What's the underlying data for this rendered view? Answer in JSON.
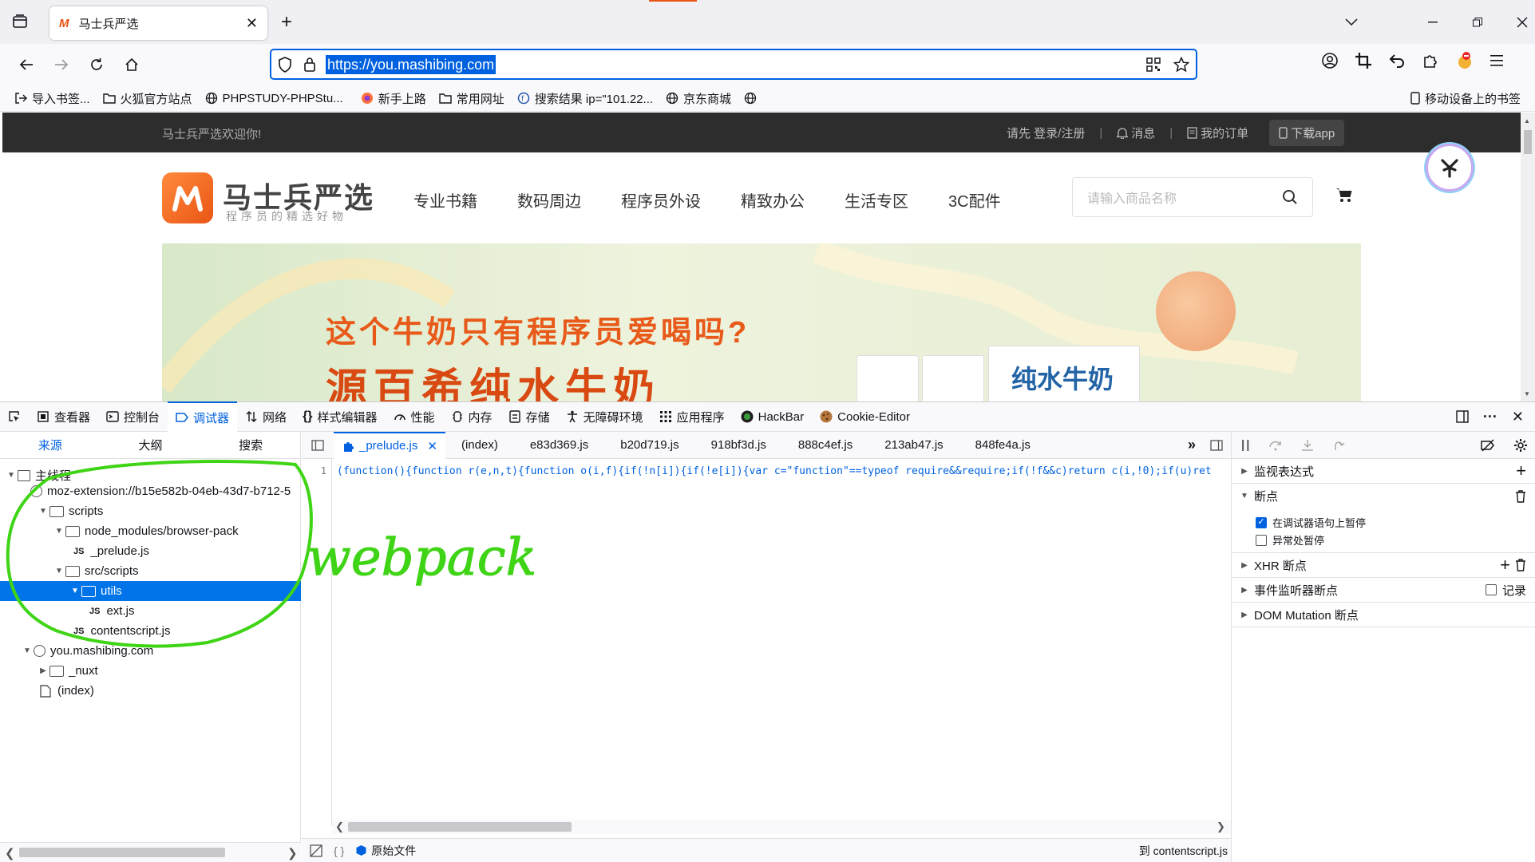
{
  "browser": {
    "tab_title": "马士兵严选",
    "url": "https://you.mashibing.com",
    "bookmarks": [
      "导入书签...",
      "火狐官方站点",
      "PHPSTUDY-PHPStu...",
      "新手上路",
      "常用网址",
      "搜索结果 ip=\"101.22...",
      "京东商城"
    ],
    "mobile_bookmarks": "移动设备上的书签"
  },
  "site": {
    "welcome": "马士兵严选欢迎你!",
    "login": "请先 登录/注册",
    "messages": "消息",
    "orders": "我的订单",
    "download": "下载app",
    "logo_name": "马士兵严选",
    "logo_sub": "程序员的精选好物",
    "nav": [
      "专业书籍",
      "数码周边",
      "程序员外设",
      "精致办公",
      "生活专区",
      "3C配件"
    ],
    "search_placeholder": "请输入商品名称",
    "banner_title": "这个牛奶只有程序员爱喝吗?",
    "banner_title2": "源百希纯水牛奶",
    "milk_label": "纯水牛奶"
  },
  "devtools": {
    "tools": [
      "查看器",
      "控制台",
      "调试器",
      "网络",
      "样式编辑器",
      "性能",
      "内存",
      "存储",
      "无障碍环境",
      "应用程序",
      "HackBar",
      "Cookie-Editor"
    ],
    "left_tabs": [
      "来源",
      "大纲",
      "搜索"
    ],
    "tree": {
      "main_thread": "主线程",
      "ext_origin": "moz-extension://b15e582b-04eb-43d7-b712-5",
      "scripts": "scripts",
      "browser_pack": "node_modules/browser-pack",
      "prelude": "_prelude.js",
      "src_scripts": "src/scripts",
      "utils": "utils",
      "ext_js": "ext.js",
      "contentscript": "contentscript.js",
      "site_origin": "you.mashibing.com",
      "nuxt": "_nuxt",
      "index": "(index)"
    },
    "editor_tabs": [
      "_prelude.js",
      "(index)",
      "e83d369.js",
      "b20d719.js",
      "918bf3d.js",
      "888c4ef.js",
      "213ab47.js",
      "848fe4a.js"
    ],
    "line_number": "1",
    "code_line": "(function(){function r(e,n,t){function o(i,f){if(!n[i]){if(!e[i]){var c=\"function\"==typeof require&&require;if(!f&&c)return c(i,!0);if(u)ret",
    "footer_original": "原始文件",
    "footer_braces": "{ }",
    "footer_right": "到 contentscript.js",
    "right": {
      "watch": "监视表达式",
      "breakpoints": "断点",
      "pause_debugger": "在调试器语句上暂停",
      "pause_exceptions": "异常处暂停",
      "xhr": "XHR 断点",
      "event_listeners": "事件监听器断点",
      "log": "记录",
      "dom_mutation": "DOM Mutation 断点"
    }
  },
  "annotation": {
    "text": "webpack",
    "color": "#3fd416"
  }
}
